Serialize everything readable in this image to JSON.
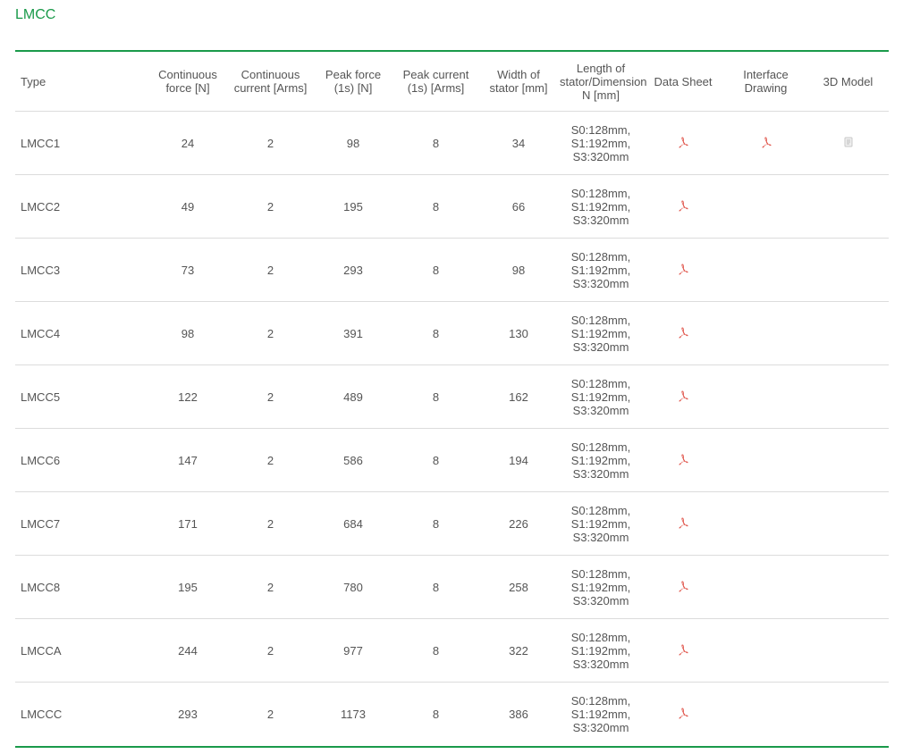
{
  "title": "LMCC",
  "columns": {
    "type": "Type",
    "cont_force": [
      "Continuous",
      "force [N]"
    ],
    "cont_current": [
      "Continuous",
      "current [Arms]"
    ],
    "peak_force": [
      "Peak force",
      "(1s) [N]"
    ],
    "peak_current": [
      "Peak current",
      "(1s) [Arms]"
    ],
    "width": [
      "Width of",
      "stator [mm]"
    ],
    "length": [
      "Length of",
      "stator/Dimension",
      "N [mm]"
    ],
    "datasheet": "Data Sheet",
    "interface": [
      "Interface",
      "Drawing"
    ],
    "model": "3D Model"
  },
  "rows": [
    {
      "type": "LMCC1",
      "cont_force": "24",
      "cont_current": "2",
      "peak_force": "98",
      "peak_current": "8",
      "width": "34",
      "length": [
        "S0:128mm,",
        "S1:192mm,",
        "S3:320mm"
      ],
      "datasheet_icon": "pdf-icon",
      "interface_icon": "pdf-icon",
      "model_icon": "file-icon"
    },
    {
      "type": "LMCC2",
      "cont_force": "49",
      "cont_current": "2",
      "peak_force": "195",
      "peak_current": "8",
      "width": "66",
      "length": [
        "S0:128mm,",
        "S1:192mm,",
        "S3:320mm"
      ],
      "datasheet_icon": "pdf-icon"
    },
    {
      "type": "LMCC3",
      "cont_force": "73",
      "cont_current": "2",
      "peak_force": "293",
      "peak_current": "8",
      "width": "98",
      "length": [
        "S0:128mm,",
        "S1:192mm,",
        "S3:320mm"
      ],
      "datasheet_icon": "pdf-icon"
    },
    {
      "type": "LMCC4",
      "cont_force": "98",
      "cont_current": "2",
      "peak_force": "391",
      "peak_current": "8",
      "width": "130",
      "length": [
        "S0:128mm,",
        "S1:192mm,",
        "S3:320mm"
      ],
      "datasheet_icon": "pdf-icon"
    },
    {
      "type": "LMCC5",
      "cont_force": "122",
      "cont_current": "2",
      "peak_force": "489",
      "peak_current": "8",
      "width": "162",
      "length": [
        "S0:128mm,",
        "S1:192mm,",
        "S3:320mm"
      ],
      "datasheet_icon": "pdf-icon"
    },
    {
      "type": "LMCC6",
      "cont_force": "147",
      "cont_current": "2",
      "peak_force": "586",
      "peak_current": "8",
      "width": "194",
      "length": [
        "S0:128mm,",
        "S1:192mm,",
        "S3:320mm"
      ],
      "datasheet_icon": "pdf-icon"
    },
    {
      "type": "LMCC7",
      "cont_force": "171",
      "cont_current": "2",
      "peak_force": "684",
      "peak_current": "8",
      "width": "226",
      "length": [
        "S0:128mm,",
        "S1:192mm,",
        "S3:320mm"
      ],
      "datasheet_icon": "pdf-icon"
    },
    {
      "type": "LMCC8",
      "cont_force": "195",
      "cont_current": "2",
      "peak_force": "780",
      "peak_current": "8",
      "width": "258",
      "length": [
        "S0:128mm,",
        "S1:192mm,",
        "S3:320mm"
      ],
      "datasheet_icon": "pdf-icon"
    },
    {
      "type": "LMCCA",
      "cont_force": "244",
      "cont_current": "2",
      "peak_force": "977",
      "peak_current": "8",
      "width": "322",
      "length": [
        "S0:128mm,",
        "S1:192mm,",
        "S3:320mm"
      ],
      "datasheet_icon": "pdf-icon"
    },
    {
      "type": "LMCCC",
      "cont_force": "293",
      "cont_current": "2",
      "peak_force": "1173",
      "peak_current": "8",
      "width": "386",
      "length": [
        "S0:128mm,",
        "S1:192mm,",
        "S3:320mm"
      ],
      "datasheet_icon": "pdf-icon"
    }
  ],
  "colors": {
    "accent": "#1a9a4a",
    "text": "#555555",
    "divider": "#dcdcdc",
    "pdf_icon": "#e0544a"
  }
}
